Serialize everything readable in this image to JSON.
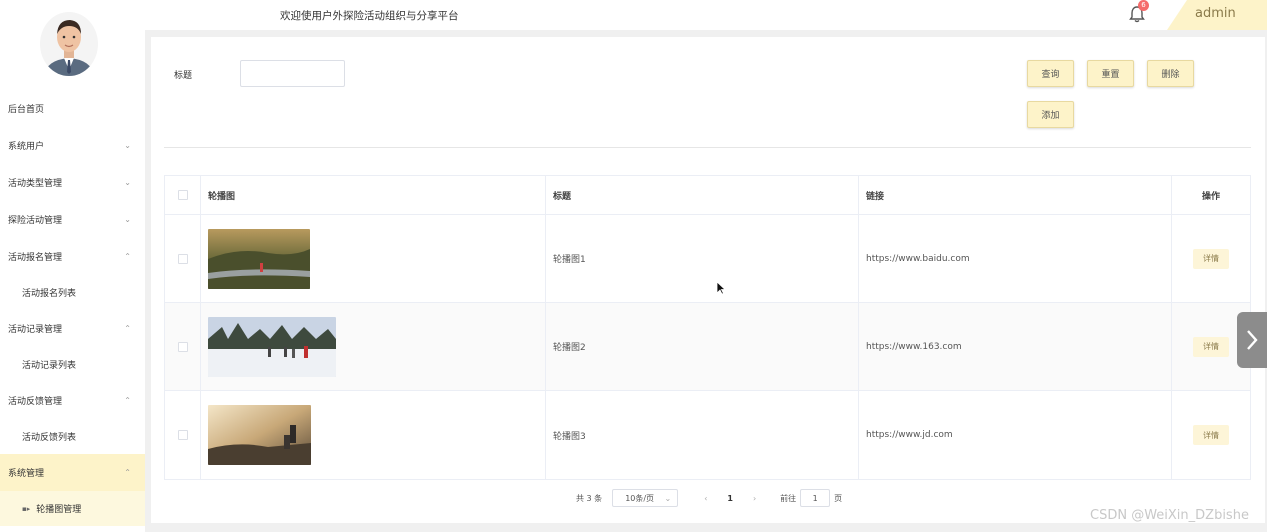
{
  "header": {
    "welcome": "欢迎使用户外探险活动组织与分享平台",
    "notification_count": "6",
    "user": "admin"
  },
  "sidebar": {
    "items": [
      {
        "label": "后台首页",
        "type": "item",
        "chev": ""
      },
      {
        "label": "系统用户",
        "type": "item",
        "chev": "⌄"
      },
      {
        "label": "活动类型管理",
        "type": "item",
        "chev": "⌄"
      },
      {
        "label": "探险活动管理",
        "type": "item",
        "chev": "⌄"
      },
      {
        "label": "活动报名管理",
        "type": "item",
        "chev": "⌃"
      },
      {
        "label": "活动报名列表",
        "type": "sub",
        "chev": ""
      },
      {
        "label": "活动记录管理",
        "type": "item",
        "chev": "⌃"
      },
      {
        "label": "活动记录列表",
        "type": "sub",
        "chev": ""
      },
      {
        "label": "活动反馈管理",
        "type": "item",
        "chev": "⌃"
      },
      {
        "label": "活动反馈列表",
        "type": "sub",
        "chev": ""
      },
      {
        "label": "系统管理",
        "type": "active-parent",
        "chev": "⌃"
      },
      {
        "label": "轮播图管理",
        "type": "active-sub",
        "chev": ""
      }
    ]
  },
  "search": {
    "label": "标题",
    "value": "",
    "buttons": {
      "query": "查询",
      "reset": "重置",
      "delete": "删除",
      "add": "添加"
    }
  },
  "table": {
    "headers": [
      "轮播图",
      "标题",
      "链接",
      "操作"
    ],
    "rows": [
      {
        "title": "轮播图1",
        "link": "https://www.baidu.com",
        "action": "详情"
      },
      {
        "title": "轮播图2",
        "link": "https://www.163.com",
        "action": "详情"
      },
      {
        "title": "轮播图3",
        "link": "https://www.jd.com",
        "action": "详情"
      }
    ]
  },
  "pagination": {
    "total": "共 3 条",
    "page_size": "10条/页",
    "current": "1",
    "goto_label": "前往",
    "goto_value": "1",
    "page_suffix": "页"
  },
  "watermark": "CSDN @WeiXin_DZbishe",
  "colors": {
    "accent": "#fdf3c9",
    "badge": "#f56c6c"
  }
}
